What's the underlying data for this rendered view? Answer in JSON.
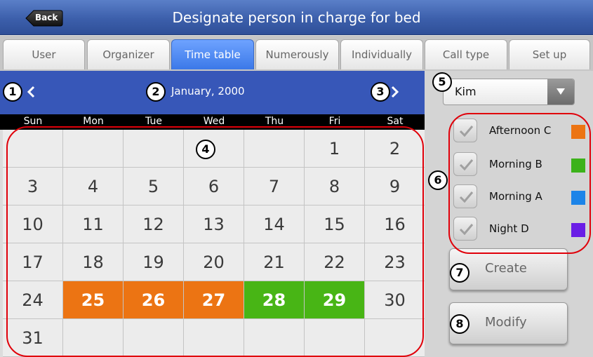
{
  "window": {
    "title": "Designate person in charge for bed",
    "back_label": "Back"
  },
  "tabs": [
    {
      "label": "User",
      "active": false
    },
    {
      "label": "Organizer",
      "active": false
    },
    {
      "label": "Time table",
      "active": true
    },
    {
      "label": "Numerously",
      "active": false
    },
    {
      "label": "Individually",
      "active": false
    },
    {
      "label": "Call type",
      "active": false
    },
    {
      "label": "Set up",
      "active": false
    }
  ],
  "calendar": {
    "month_label": "January, 2000",
    "prev_icon": "chevron-left-icon",
    "next_icon": "chevron-right-icon",
    "weekdays": [
      "Sun",
      "Mon",
      "Tue",
      "Wed",
      "Thu",
      "Fri",
      "Sat"
    ],
    "rows": [
      [
        "",
        "",
        "",
        "",
        "",
        "1",
        "2"
      ],
      [
        "3",
        "4",
        "5",
        "6",
        "7",
        "8",
        "9"
      ],
      [
        "10",
        "11",
        "12",
        "13",
        "14",
        "15",
        "16"
      ],
      [
        "17",
        "18",
        "19",
        "20",
        "21",
        "22",
        "23"
      ],
      [
        "24",
        "25",
        "26",
        "27",
        "28",
        "29",
        "30"
      ],
      [
        "31",
        "",
        "",
        "",
        "",
        "",
        ""
      ]
    ],
    "highlights": {
      "25": "orange",
      "26": "orange",
      "27": "orange",
      "28": "green",
      "29": "green"
    },
    "highlight_colors": {
      "orange": "#ec7413",
      "green": "#48b515"
    }
  },
  "person_select": {
    "selected": "Kim",
    "icon": "dropdown-arrow-icon"
  },
  "shifts": [
    {
      "label": "Afternoon C",
      "color": "#ec7413",
      "checked": true
    },
    {
      "label": "Morning B",
      "color": "#3cb21a",
      "checked": true
    },
    {
      "label": "Morning A",
      "color": "#1c84e8",
      "checked": true
    },
    {
      "label": "Night D",
      "color": "#6a1de6",
      "checked": true
    }
  ],
  "buttons": {
    "create": "Create",
    "modify": "Modify"
  },
  "annotations": {
    "n1": "1",
    "n2": "2",
    "n3": "3",
    "n4": "4",
    "n5": "5",
    "n6": "6",
    "n7": "7",
    "n8": "8"
  },
  "annotation_color": "#e0000a"
}
